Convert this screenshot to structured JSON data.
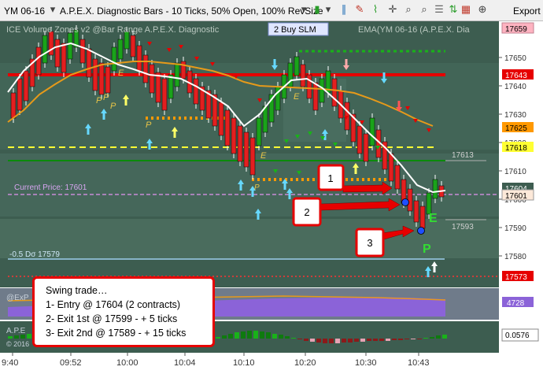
{
  "toolbar": {
    "instrument": "YM 06-16",
    "bar_type": "A.P.E.X. Diagnostic Bars - 10 Ticks, 50% Open, 100% RevSize",
    "export_label": "Export"
  },
  "panel": {
    "indicator_labels": "ICE Volume Zones v2 @Bar Range A.P.E.X. Diagnostic",
    "order_label": "2  Buy SLM",
    "ema_label": "EMA(YM 06-16 (A.P.E.X. Dia"
  },
  "price_labels": {
    "right": [
      "17659",
      "17643",
      "17625",
      "17618",
      "17604",
      "17601",
      "17573"
    ],
    "inner": [
      "17613",
      "17593"
    ],
    "current": "Current Price: 17601",
    "sigma": "-0.5 Dσ 17579"
  },
  "axis": {
    "price_ticks": [
      "17650",
      "17640",
      "17630",
      "17620",
      "17610",
      "17600",
      "17590",
      "17580"
    ],
    "time_ticks": [
      "9:40",
      "09:52",
      "10:00",
      "10:04",
      "10:10",
      "10:20",
      "10:30",
      "10:43"
    ]
  },
  "signals": {
    "bar_letters": [
      "P",
      "E",
      "P",
      "P",
      "E",
      "P",
      "E",
      "P"
    ],
    "E_label": "E",
    "P_label": "P"
  },
  "callouts": [
    "1",
    "2",
    "3"
  ],
  "textbox": {
    "lines": [
      "Swing trade…",
      "1- Entry @ 17604 (2 contracts)",
      "2- Exit 1st @ 17599 - + 5 ticks",
      "3- Exit 2nd @ 17589 - + 15 ticks"
    ]
  },
  "sub_panels": {
    "volume_label": "@ExP",
    "volume_value": "4728",
    "lower_label": "A.P.E",
    "lower_value": "0.0576",
    "copyright": "© 2016"
  },
  "colors": {
    "bull": "#1aa31a",
    "bear": "#e41f1f",
    "background": "#3d5d50",
    "red_line": "#e60000",
    "yellow_line": "#ffff33",
    "orange_dots": "#ff9900",
    "green_line": "#007a00"
  }
}
